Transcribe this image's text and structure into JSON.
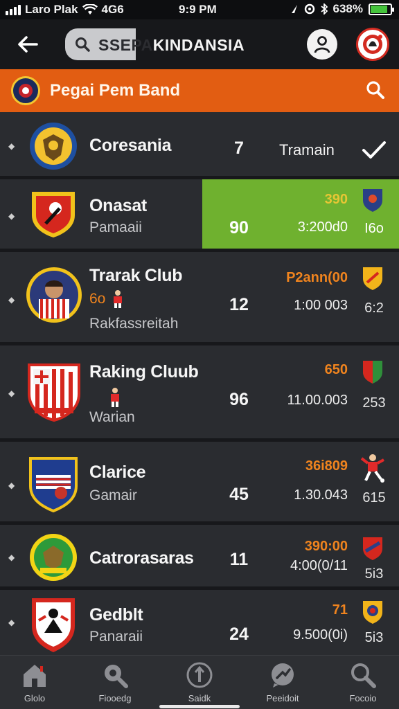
{
  "status_bar": {
    "carrier": "Laro Plak",
    "network": "4G6",
    "time": "9:9 PM",
    "battery": "638%"
  },
  "top_bar": {
    "search_value": "SSEPAKINDANSIA",
    "search_value_dim": "SSEPA",
    "search_value_bright": "KINDANSIA"
  },
  "league": {
    "title": "Pegai Pem Band"
  },
  "teams": [
    {
      "name": "Coresania",
      "points": "7",
      "right_label": "Tramain"
    },
    {
      "name": "Onasat",
      "subtitle": "Pamaaii",
      "points": "90",
      "top_value": "390",
      "amount": "3:200d0",
      "side_value": "I6o"
    },
    {
      "name": "Trarak Club",
      "extra": "6o",
      "subtitle": "Rakfassreitah",
      "points": "12",
      "top_value": "P2ann(00",
      "amount": "1:00 003",
      "side_value": "6:2"
    },
    {
      "name": "Raking Cluub",
      "subtitle": "Warian",
      "points": "96",
      "top_value": "650",
      "amount": "11.00.003",
      "side_value": "253"
    },
    {
      "name": "Clarice",
      "subtitle": "Gamair",
      "points": "45",
      "top_value": "36i809",
      "amount": "1.30.043",
      "side_value": "615"
    },
    {
      "name": "Catrorasaras",
      "points": "11",
      "top_value": "390:00",
      "amount": "4:00(0/11",
      "side_value": "5i3"
    },
    {
      "name": "Gedblt",
      "subtitle": "Panaraii",
      "points": "24",
      "top_value": "71",
      "amount": "9.500(0i)",
      "side_value": "5i3"
    }
  ],
  "nav": [
    {
      "label": "Glolo",
      "icon": "home-icon"
    },
    {
      "label": "Fiooedg",
      "icon": "search-icon"
    },
    {
      "label": "Saidk",
      "icon": "compass-icon"
    },
    {
      "label": "Peeidoit",
      "icon": "chat-icon"
    },
    {
      "label": "Focoio",
      "icon": "magnifier-icon"
    }
  ],
  "colors": {
    "accent": "#e25d12",
    "highlight": "#6fb12f",
    "value_orange": "#f0841e",
    "background": "#27292d"
  }
}
